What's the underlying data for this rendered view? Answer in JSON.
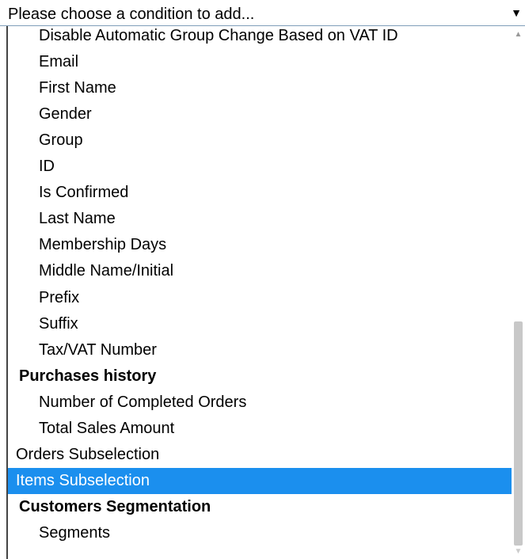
{
  "select": {
    "value": "Please choose a condition to add..."
  },
  "options": [
    {
      "label": "Disable Automatic Group Change Based on VAT ID",
      "kind": "l1"
    },
    {
      "label": "Email",
      "kind": "l1"
    },
    {
      "label": "First Name",
      "kind": "l1"
    },
    {
      "label": "Gender",
      "kind": "l1"
    },
    {
      "label": "Group",
      "kind": "l1"
    },
    {
      "label": "ID",
      "kind": "l1"
    },
    {
      "label": "Is Confirmed",
      "kind": "l1"
    },
    {
      "label": "Last Name",
      "kind": "l1"
    },
    {
      "label": "Membership Days",
      "kind": "l1"
    },
    {
      "label": "Middle Name/Initial",
      "kind": "l1"
    },
    {
      "label": "Prefix",
      "kind": "l1"
    },
    {
      "label": "Suffix",
      "kind": "l1"
    },
    {
      "label": "Tax/VAT Number",
      "kind": "l1"
    },
    {
      "label": "Purchases history",
      "kind": "group"
    },
    {
      "label": "Number of Completed Orders",
      "kind": "l1"
    },
    {
      "label": "Total Sales Amount",
      "kind": "l1"
    },
    {
      "label": "Orders Subselection",
      "kind": "l0"
    },
    {
      "label": "Items Subselection",
      "kind": "l0",
      "selected": true
    },
    {
      "label": "Customers Segmentation",
      "kind": "group"
    },
    {
      "label": "Segments",
      "kind": "l1"
    }
  ],
  "icons": {
    "dropdown_arrow": "triangle-down-icon",
    "scroll_up": "scroll-up-arrow-icon",
    "scroll_down": "scroll-down-arrow-icon"
  },
  "colors": {
    "selected_bg": "#1b8fee",
    "selected_fg": "#ffffff",
    "scroll_thumb": "#c8c8c8"
  }
}
